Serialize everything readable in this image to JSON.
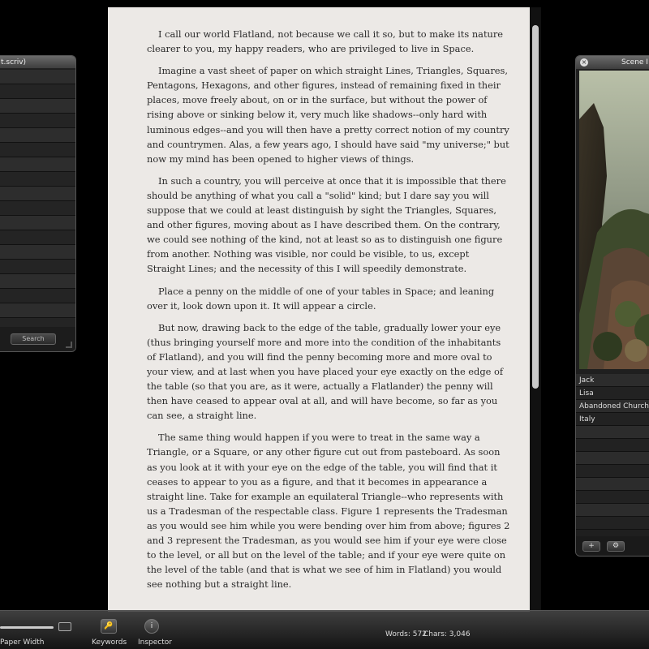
{
  "left_panel": {
    "title": "t.scriv)",
    "row_count": 20,
    "search_button": "Search"
  },
  "document": {
    "paragraphs": [
      "I call our world Flatland, not because we call it so, but to make its nature clearer to you, my happy readers, who are privileged to live in Space.",
      "Imagine a vast sheet of paper on which straight Lines, Triangles, Squares, Pentagons, Hexagons, and other figures, instead of remaining fixed in their places, move freely about, on or in the surface, but without the power of rising above or sinking below it, very much like shadows--only hard with luminous edges--and you will then have a pretty correct notion of my country and countrymen.  Alas, a few years ago, I should have said \"my universe;\"  but now my mind has been opened to higher views of things.",
      "In such a country, you will perceive at once that it is impossible that there should be anything of what you call a \"solid\" kind; but I dare say you will suppose that we could at least distinguish by sight the Triangles, Squares, and other figures, moving about as I have described them. On the contrary, we could see nothing of the kind, not at least so as to distinguish one figure from another. Nothing was visible, nor could be visible, to us, except Straight Lines; and the necessity of this I will speedily demonstrate.",
      "Place a penny on the middle of one of your tables in Space; and leaning over it, look down upon it.  It will appear a circle.",
      "But now, drawing back to the edge of the table, gradually lower your eye (thus bringing yourself more and more into the condition of the inhabitants of Flatland), and you will find the penny becoming more and more oval to your view, and at last when you have placed your eye exactly on the edge of the table (so that you are, as it were, actually a Flatlander) the penny will then have ceased to appear oval at all, and will have become, so far as you can see, a straight line.",
      "The same thing would happen if you were to treat in the same way a Triangle, or a Square, or any other figure cut out from pasteboard.  As soon as you look at it with your eye on the edge of the table, you will find that it ceases to appear to you as a figure, and that it becomes in appearance a straight line. Take for example an equilateral Triangle--who represents with us a Tradesman of the respectable class.  Figure 1 represents the Tradesman as you would see him while you were bending over him from above; figures 2 and 3 represent the Tradesman, as you would see him if your eye were close to the level, or all but on the level of the table; and if your eye were quite on the level of the table (and that is what we see of him in Flatland) you would see nothing but a straight line."
    ]
  },
  "right_panel": {
    "title": "Scene I",
    "items": [
      "Jack",
      "Lisa",
      "Abandoned Church",
      "Italy",
      "",
      "",
      "",
      "",
      "",
      "",
      "",
      ""
    ],
    "add_button": "+",
    "gear_button": "⚙"
  },
  "toolbar": {
    "paper_width_label": "Paper Width",
    "keywords_label": "Keywords",
    "inspector_label": "Inspector",
    "words_label": "Words: 572",
    "chars_label": "Chars: 3,046"
  }
}
